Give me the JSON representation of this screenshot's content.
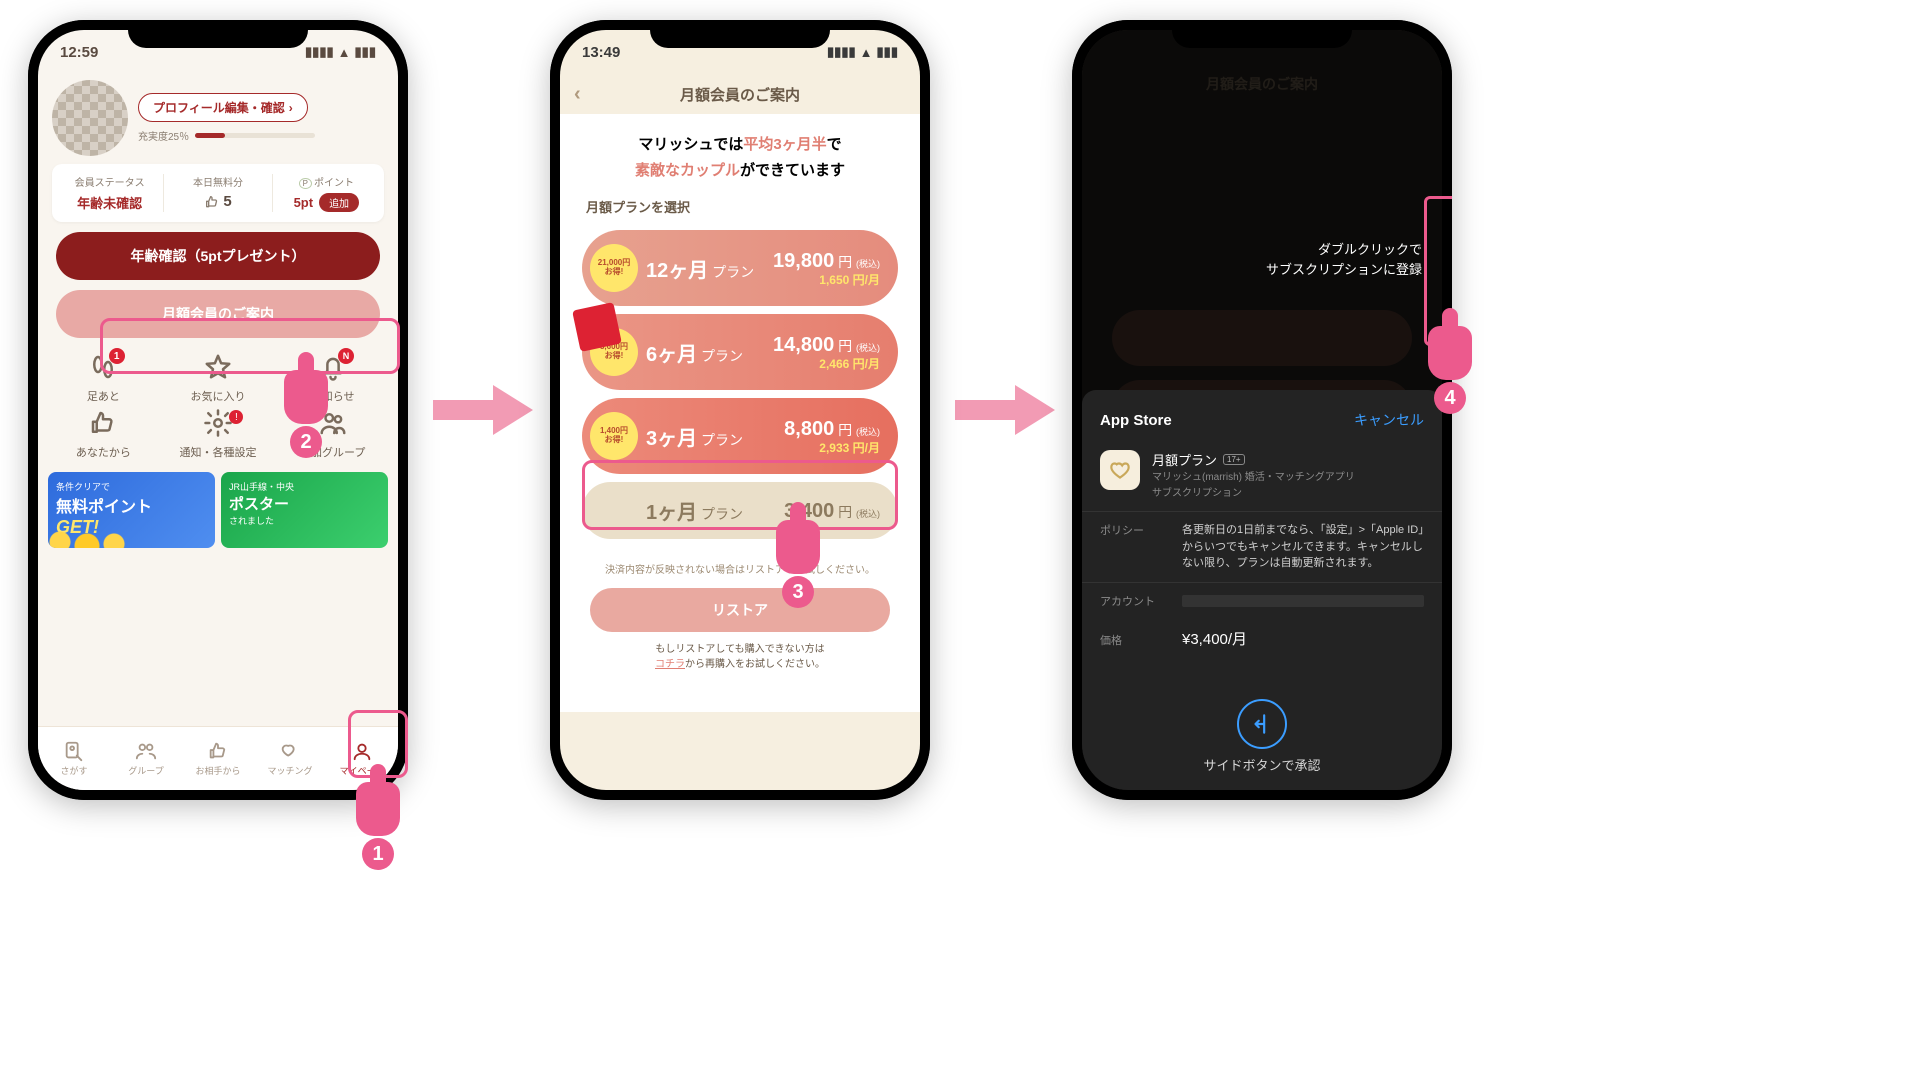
{
  "steps": {
    "one": "1",
    "two": "2",
    "three": "3",
    "four": "4"
  },
  "phone1": {
    "status": {
      "time": "12:59"
    },
    "profile": {
      "edit_label": "プロフィール編集・確認",
      "progress_label": "充実度25％"
    },
    "stats": {
      "tier_k": "会員ステータス",
      "tier_v": "年齢未確認",
      "like_k": "本日無料分",
      "like_v": "5",
      "point_k": "ポイント",
      "point_prefix": "P",
      "point_v": "5pt",
      "add_label": "追加"
    },
    "btn_age": "年齢確認（5ptプレゼント）",
    "btn_plan": "月額会員のご案内",
    "menu": {
      "m1": "足あと",
      "m2": "お気に入り",
      "m3": "お知らせ",
      "m4": "あなたから",
      "m5": "通知・各種設定",
      "m6": "参加グループ",
      "badge1": "1",
      "badgeN": "N",
      "badgeDot": "!"
    },
    "banner1": {
      "l1": "条件クリアで",
      "l2": "無料ポイント",
      "l3": "GET!"
    },
    "banner2": {
      "l1": "JR山手線・中央",
      "l2": "ポスター",
      "l3": "されました"
    },
    "tabs": {
      "t1": "さがす",
      "t2": "グループ",
      "t3": "お相手から",
      "t4": "マッチング",
      "t5": "マイページ"
    }
  },
  "phone2": {
    "status": {
      "time": "13:49"
    },
    "header": "月額会員のご案内",
    "intro": {
      "a": "マリッシュでは",
      "b": "平均3ヶ月半",
      "c": "で",
      "d": "素敵なカップル",
      "e": "ができています"
    },
    "select_label": "月額プランを選択",
    "plans": [
      {
        "save_amount": "21,000円",
        "save_word": "お得!",
        "months": "12ヶ月",
        "unit": "プラン",
        "total": "19,800",
        "yen": "円",
        "tax": "(税込)",
        "monthly": "1,650 円/月"
      },
      {
        "save_amount": "5,600円",
        "save_word": "お得!",
        "months": "6ヶ月",
        "unit": "プラン",
        "total": "14,800",
        "yen": "円",
        "tax": "(税込)",
        "monthly": "2,466 円/月"
      },
      {
        "save_amount": "1,400円",
        "save_word": "お得!",
        "months": "3ヶ月",
        "unit": "プラン",
        "total": "8,800",
        "yen": "円",
        "tax": "(税込)",
        "monthly": "2,933 円/月"
      },
      {
        "months": "1ヶ月",
        "unit": "プラン",
        "total": "3,400",
        "yen": "円",
        "tax": "(税込)"
      }
    ],
    "note": "決済内容が反映されない場合はリストアをお試しください。",
    "restore_label": "リストア",
    "note2_a": "もしリストアしても購入できない方は",
    "note2_link": "コチラ",
    "note2_b": "から再購入をお試しください。"
  },
  "phone3": {
    "header": "月額会員のご案内",
    "double_click_l1": "ダブルクリックで",
    "double_click_l2": "サブスクリプションに登録",
    "sheet": {
      "store": "App Store",
      "cancel": "キャンセル",
      "plan_title": "月額プラン",
      "age_badge": "17+",
      "app_name": "マリッシュ(marrish) 婚活・マッチングアプリ",
      "sub_type": "サブスクリプション",
      "policy_k": "ポリシー",
      "policy_v": "各更新日の1日前までなら、「設定」>「Apple ID」からいつでもキャンセルできます。キャンセルしない限り、プランは自動更新されます。",
      "account_k": "アカウント",
      "price_k": "価格",
      "price_v": "¥3,400/月",
      "confirm": "サイドボタンで承認"
    }
  }
}
